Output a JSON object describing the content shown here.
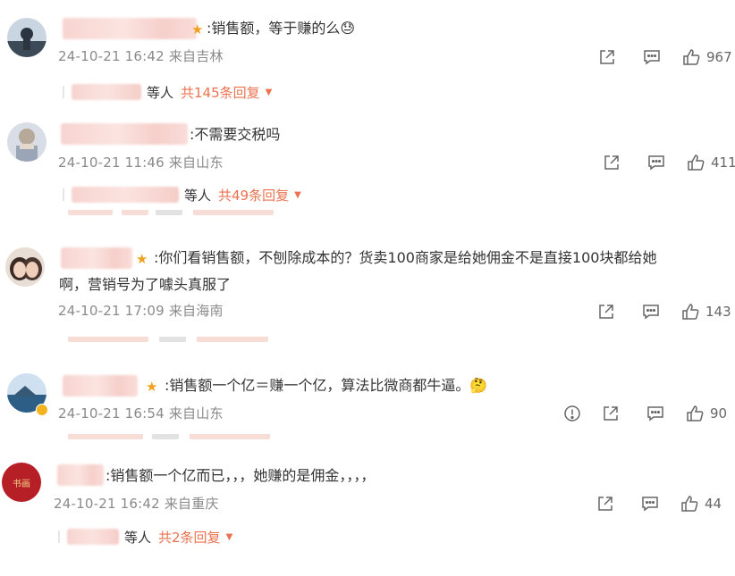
{
  "comments": [
    {
      "content": ":销售额，等于赚的么😓",
      "meta": "24-10-21 16:42 来自吉林",
      "likes": "967",
      "reply": {
        "people": "等人",
        "total": "共145条回复"
      }
    },
    {
      "content": ":不需要交税吗",
      "meta": "24-10-21 11:46 来自山东",
      "likes": "411",
      "reply": {
        "people": "等人",
        "total": "共49条回复"
      }
    },
    {
      "content_line1": ":你们看销售额，不刨除成本的？货卖100商家是给她佣金不是直接100块都给她",
      "content_line2": "啊，营销号为了噱头真服了",
      "meta": "24-10-21 17:09 来自海南",
      "likes": "143"
    },
    {
      "content": ":销售额一个亿＝赚一个亿，算法比微商都牛逼。🤔",
      "meta": "24-10-21 16:54 来自山东",
      "likes": "90"
    },
    {
      "content": ":销售额一个亿而已，，，她赚的是佣金，，，，",
      "meta": "24-10-21 16:42 来自重庆",
      "likes": "44",
      "reply": {
        "people": "等人",
        "total": "共2条回复"
      }
    }
  ],
  "icons": {
    "share": "share-icon",
    "comment": "comment-icon",
    "like": "like-icon",
    "report": "report-icon",
    "expand": "chevron-down-icon"
  },
  "colors": {
    "accent": "#eb7350",
    "meta_text": "#8a8a8a",
    "body_text": "#333333"
  }
}
